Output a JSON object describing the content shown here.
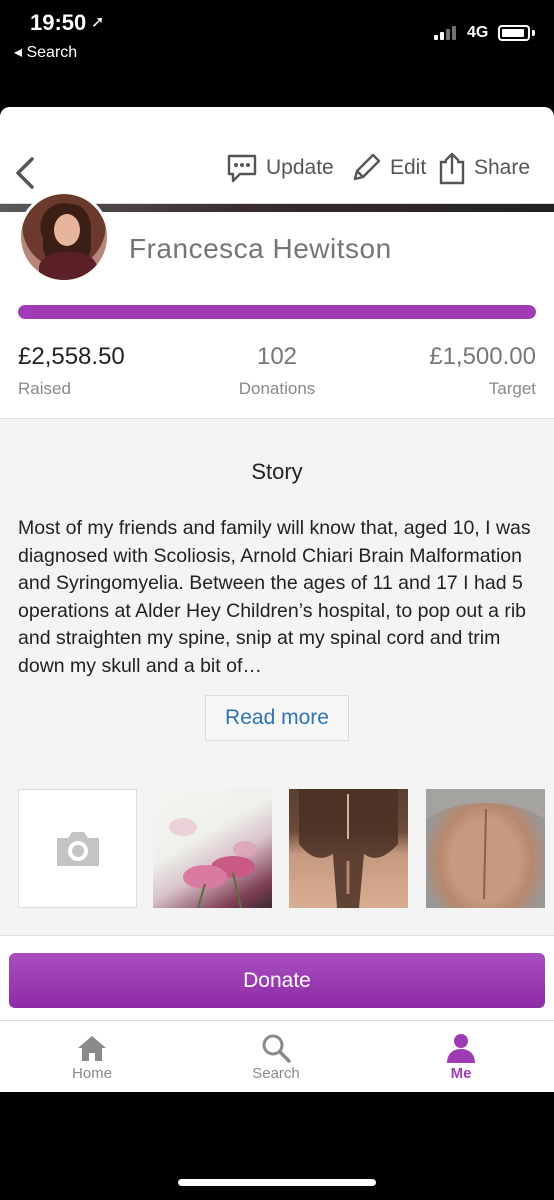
{
  "status_bar": {
    "time": "19:50",
    "back_app": "◂ Search",
    "network": "4G"
  },
  "header": {
    "update_label": "Update",
    "edit_label": "Edit",
    "share_label": "Share"
  },
  "profile": {
    "name": "Francesca Hewitson"
  },
  "progress": {
    "fraction": 1.0,
    "color": "#9f3bb4"
  },
  "stats": {
    "raised_value": "£2,558.50",
    "raised_label": "Raised",
    "donations_value": "102",
    "donations_label": "Donations",
    "target_value": "£1,500.00",
    "target_label": "Target"
  },
  "story": {
    "title": "Story",
    "text": "Most of my friends and family will know that, aged 10, I was diagnosed with Scoliosis, Arnold Chiari Brain Malformation and Syringomyelia. Between the ages of 11 and 17 I had 5 operations at Alder Hey Children’s hospital, to pop out a rib and straighten my spine, snip at my spinal cord and trim down my skull and a bit of…",
    "read_more_label": "Read more"
  },
  "photos": {
    "add_icon": "camera-icon",
    "items": [
      "flowers-photo",
      "neck-scar-photo",
      "back-scar-photo"
    ]
  },
  "donate": {
    "label": "Donate",
    "color": "#9f3bb4"
  },
  "tabs": {
    "home_label": "Home",
    "search_label": "Search",
    "me_label": "Me",
    "active": "Me"
  }
}
